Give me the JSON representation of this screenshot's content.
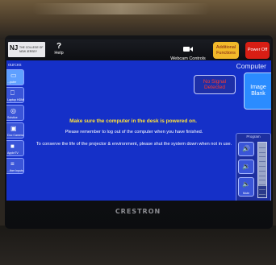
{
  "logo": {
    "mark": "NJ",
    "line1": "THE COLLEGE OF",
    "line2": "NEW JERSEY"
  },
  "toolbar": {
    "help_label": "Help",
    "webcam_label": "Webcam Controls",
    "additional_functions": "Additional Functions",
    "power_off": "Power Off"
  },
  "sources": {
    "label": "ources",
    "items": [
      {
        "label": "...puter",
        "icon": "monitor-icon",
        "active": true
      },
      {
        "label": "Laptop HDMI",
        "icon": "laptop-icon",
        "active": false
      },
      {
        "label": "Solstice",
        "icon": "wireless-icon",
        "active": false
      },
      {
        "label": "Doc Camera",
        "icon": "doc-camera-icon",
        "active": false
      },
      {
        "label": "AppleTV",
        "icon": "appletv-icon",
        "active": false
      },
      {
        "label": "...ther Inputs",
        "icon": "inputs-icon",
        "active": false
      }
    ]
  },
  "main": {
    "title": "Computer",
    "no_signal": "No Signal Detected",
    "image_blank": "Image Blank",
    "message_main": "Make sure the computer in the desk is powered on.",
    "message_logout": "Please remember to log out of the computer when you have finished.",
    "message_conserve": "To conserve the life of the projector & environment, please shut the system down when not in use."
  },
  "program": {
    "label": "Program",
    "mute_label": "Mute",
    "level_percent": 20
  },
  "device": {
    "brand": "CRESTRON"
  },
  "colors": {
    "screen_bg": "#1530c8",
    "accent_yellow": "#ffe23a",
    "power_red": "#d81e14",
    "additional_orange": "#f2b92a",
    "no_signal_text": "#ff3a2a",
    "image_blank_bg": "#2b8cff"
  }
}
